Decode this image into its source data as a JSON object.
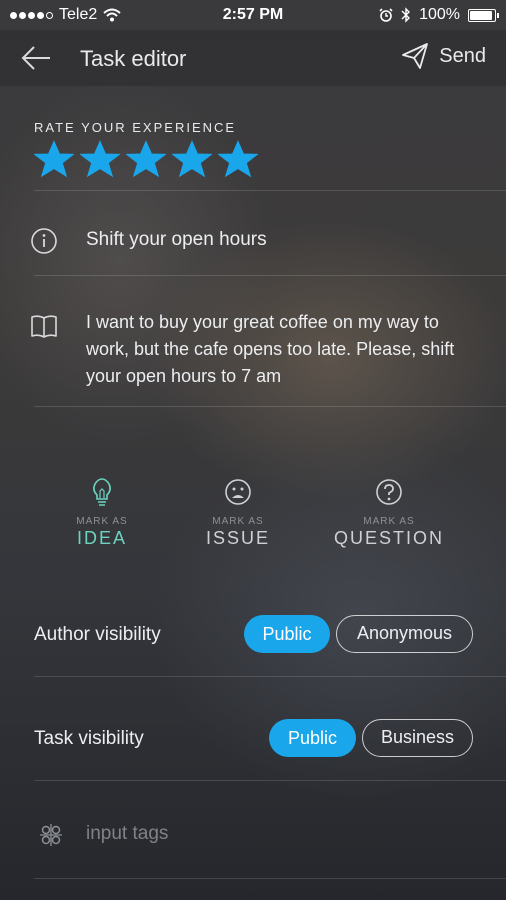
{
  "status_bar": {
    "carrier": "Tele2",
    "time": "2:57 PM",
    "battery": "100%",
    "battery_level": 1.0,
    "signal_bars_filled": 4,
    "signal_bars_total": 5,
    "icons": [
      "wifi-icon",
      "alarm-icon",
      "bluetooth-icon",
      "battery-icon"
    ]
  },
  "toolbar": {
    "title": "Task editor",
    "send_label": "Send",
    "back_icon": "back-arrow-icon",
    "send_icon": "paper-plane-icon"
  },
  "rating": {
    "label": "RATE YOUR EXPERIENCE",
    "value": 5,
    "max": 5,
    "star_color": "#1aa6ea"
  },
  "task": {
    "subject": "Shift your open hours",
    "description": "I want to buy your great coffee on my way to work, but the cafe opens too late. Please, shift your open hours to 7 am"
  },
  "marks": [
    {
      "prefix": "MARK AS",
      "label": "IDEA",
      "icon": "lightbulb-icon",
      "selected": true
    },
    {
      "prefix": "MARK AS",
      "label": "ISSUE",
      "icon": "sad-face-icon",
      "selected": false
    },
    {
      "prefix": "MARK AS",
      "label": "QUESTION",
      "icon": "question-icon",
      "selected": false
    }
  ],
  "author_visibility": {
    "label": "Author visibility",
    "options": [
      "Public",
      "Anonymous"
    ],
    "selected": "Public"
  },
  "task_visibility": {
    "label": "Task visibility",
    "options": [
      "Public",
      "Business"
    ],
    "selected": "Public"
  },
  "tags": {
    "placeholder": "input tags",
    "icon": "tags-icon"
  },
  "colors": {
    "accent": "#1aa6ea",
    "idea": "#6cd3c0"
  }
}
